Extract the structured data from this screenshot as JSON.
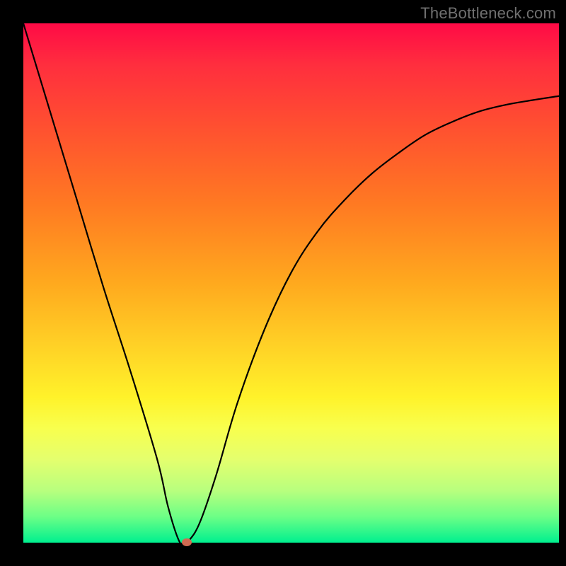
{
  "watermark": "TheBottleneck.com",
  "chart_data": {
    "type": "line",
    "title": "",
    "xlabel": "",
    "ylabel": "",
    "xlim": [
      0,
      100
    ],
    "ylim": [
      0,
      100
    ],
    "grid": false,
    "legend": false,
    "background_gradient": [
      "#ff0a46",
      "#ffa91e",
      "#fff22a",
      "#00f08f"
    ],
    "series": [
      {
        "name": "bottleneck-curve",
        "color": "#000000",
        "x": [
          0,
          5,
          10,
          15,
          20,
          25,
          27,
          29,
          30,
          31,
          33,
          36,
          40,
          45,
          50,
          55,
          60,
          65,
          70,
          75,
          80,
          85,
          90,
          95,
          100
        ],
        "values": [
          100,
          83,
          66,
          49,
          33,
          16,
          7,
          0.5,
          0,
          0.5,
          4,
          13,
          27,
          41,
          52,
          60,
          66,
          71,
          75,
          78.5,
          81,
          83,
          84.3,
          85.2,
          86
        ]
      }
    ],
    "annotations": [
      {
        "name": "min-marker",
        "x": 30.5,
        "y": 0,
        "color": "#cf6a52"
      }
    ]
  }
}
